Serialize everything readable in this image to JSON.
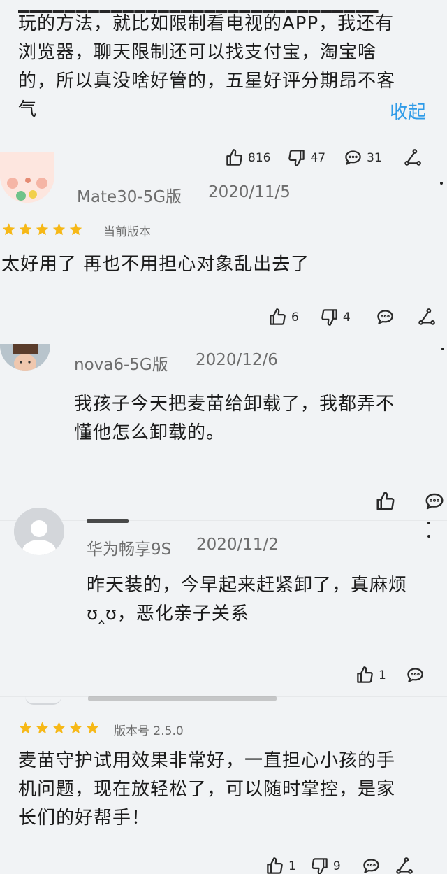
{
  "review1": {
    "lines": [
      "玩的方法，就比如限制看电视的APP，我还有",
      "浏览器，聊天限制还可以找支付宝，淘宝啥",
      "的，所以真没啥好管的，五星好评分期昂不客",
      "气"
    ],
    "collapse_label": "收起",
    "likes": "816",
    "dislikes": "47",
    "comments": "31"
  },
  "review2": {
    "device": "Mate30-5G版",
    "date": "2020/11/5",
    "version_label": "当前版本",
    "text": "太好用了 再也不用担心对象乱出去了",
    "likes": "6",
    "dislikes": "4"
  },
  "review3": {
    "device": "nova6-5G版",
    "date": "2020/12/6",
    "lines": [
      "我孩子今天把麦苗给卸载了，我都弄不",
      "懂他怎么卸载的。"
    ]
  },
  "review4": {
    "device": "华为畅享9S",
    "date": "2020/11/2",
    "lines": [
      "昨天装的，今早起来赶紧卸了，真麻烦",
      "ʊ‸ʊ，恶化亲子关系"
    ],
    "likes": "1"
  },
  "review5": {
    "version_label": "版本号 2.5.0",
    "lines": [
      "麦苗守护试用效果非常好，一直担心小孩的手",
      "机问题，现在放轻松了，可以随时掌控，是家",
      "长们的好帮手！"
    ],
    "likes": "1",
    "dislikes": "9"
  },
  "rating_stars": 5,
  "colors": {
    "accent": "#2f9be8",
    "star": "#f6b817",
    "background": "#f1f3f5"
  }
}
